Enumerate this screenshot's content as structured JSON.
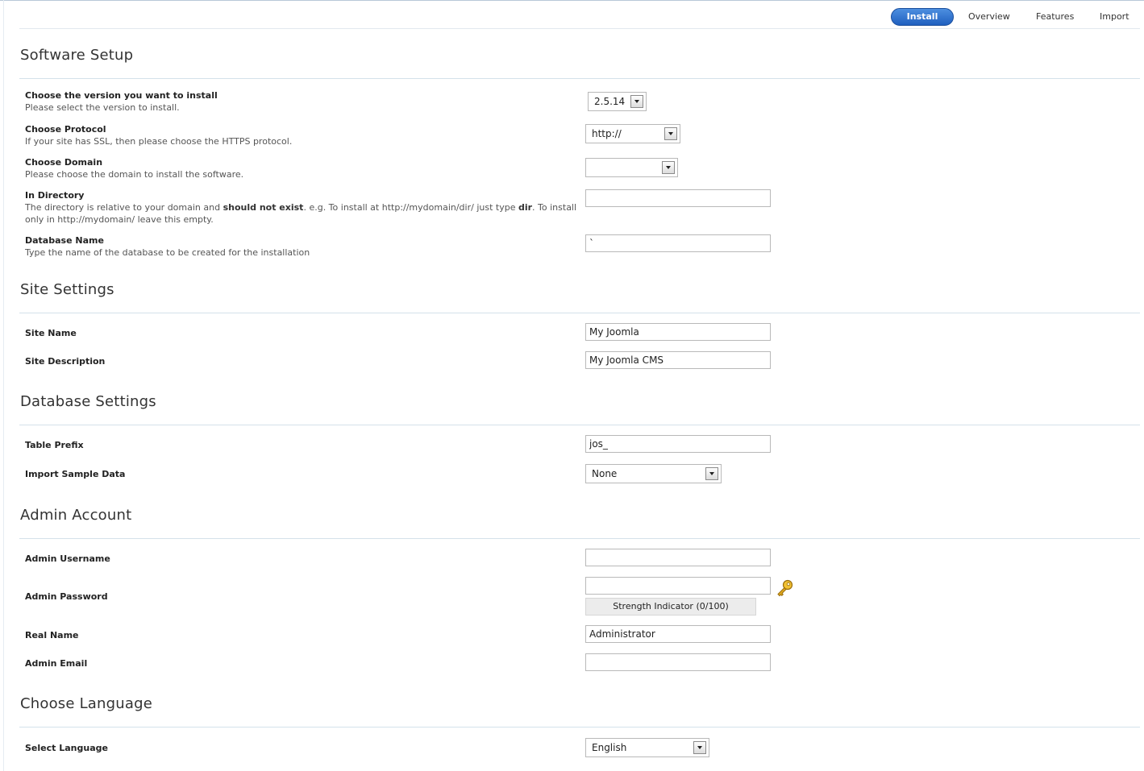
{
  "tabs": {
    "install": "Install",
    "overview": "Overview",
    "features": "Features",
    "import": "Import"
  },
  "software_setup": {
    "title": "Software Setup",
    "version": {
      "label": "Choose the version you want to install",
      "help": "Please select the version to install.",
      "value": "2.5.14"
    },
    "protocol": {
      "label": "Choose Protocol",
      "help": "If your site has SSL, then please choose the HTTPS protocol.",
      "value": "http://"
    },
    "domain": {
      "label": "Choose Domain",
      "help": "Please choose the domain to install the software.",
      "value": ""
    },
    "directory": {
      "label": "In Directory",
      "help_1": "The directory is relative to your domain and ",
      "help_bold_1": "should not exist",
      "help_2": ". e.g. To install at http://mydomain/dir/ just type ",
      "help_bold_2": "dir",
      "help_3": ". To install only in http://mydomain/ leave this empty.",
      "value": ""
    },
    "database_name": {
      "label": "Database Name",
      "help": "Type the name of the database to be created for the installation",
      "value": "`"
    }
  },
  "site_settings": {
    "title": "Site Settings",
    "site_name": {
      "label": "Site Name",
      "value": "My Joomla"
    },
    "site_description": {
      "label": "Site Description",
      "value": "My Joomla CMS"
    }
  },
  "database_settings": {
    "title": "Database Settings",
    "table_prefix": {
      "label": "Table Prefix",
      "value": "jos_"
    },
    "sample_data": {
      "label": "Import Sample Data",
      "value": "None"
    }
  },
  "admin_account": {
    "title": "Admin Account",
    "username": {
      "label": "Admin Username",
      "value": ""
    },
    "password": {
      "label": "Admin Password",
      "value": ""
    },
    "strength": "Strength Indicator (0/100)",
    "real_name": {
      "label": "Real Name",
      "value": "Administrator"
    },
    "email": {
      "label": "Admin Email",
      "value": ""
    }
  },
  "language": {
    "title": "Choose Language",
    "select": {
      "label": "Select Language",
      "value": "English"
    }
  },
  "colors": {
    "accent": "#1f5fbf",
    "section_line": "#d4e1ea"
  },
  "icons": {
    "password_generator": "key-icon",
    "dropdown": "chevron-down-icon"
  }
}
